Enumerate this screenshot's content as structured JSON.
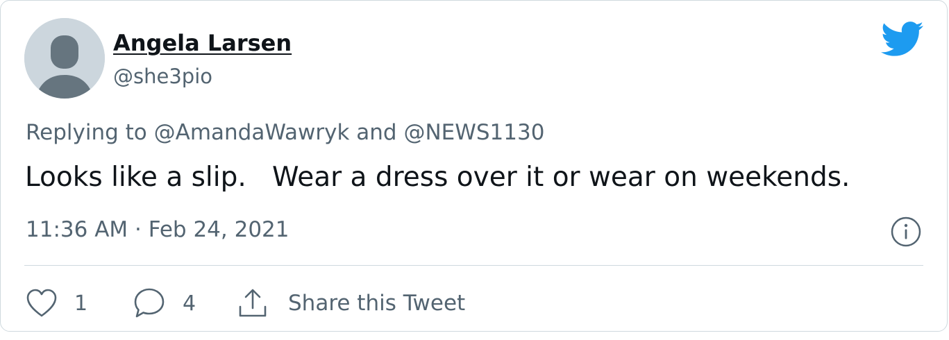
{
  "user": {
    "name": "Angela Larsen",
    "handle": "@she3pio"
  },
  "reply": {
    "prefix": "Replying to ",
    "mention1": "@AmandaWawryk",
    "conjunction": " and ",
    "mention2": "@NEWS1130"
  },
  "tweet": {
    "text": "Looks like a slip.   Wear a dress over it or wear on weekends.",
    "timestamp": "11:36 AM · Feb 24, 2021"
  },
  "actions": {
    "likes": "1",
    "replies": "4",
    "share_label": "Share this Tweet"
  },
  "icons": {
    "brand": "twitter-bird-icon",
    "info": "info-icon",
    "like": "heart-icon",
    "reply": "speech-bubble-icon",
    "share": "share-upload-icon"
  },
  "colors": {
    "brand_blue": "#1d9bf0",
    "text_primary": "#0f1419",
    "text_secondary": "#536471",
    "border": "#cfd9de",
    "avatar_bg": "#ccd6dd",
    "avatar_fg": "#66757f"
  }
}
